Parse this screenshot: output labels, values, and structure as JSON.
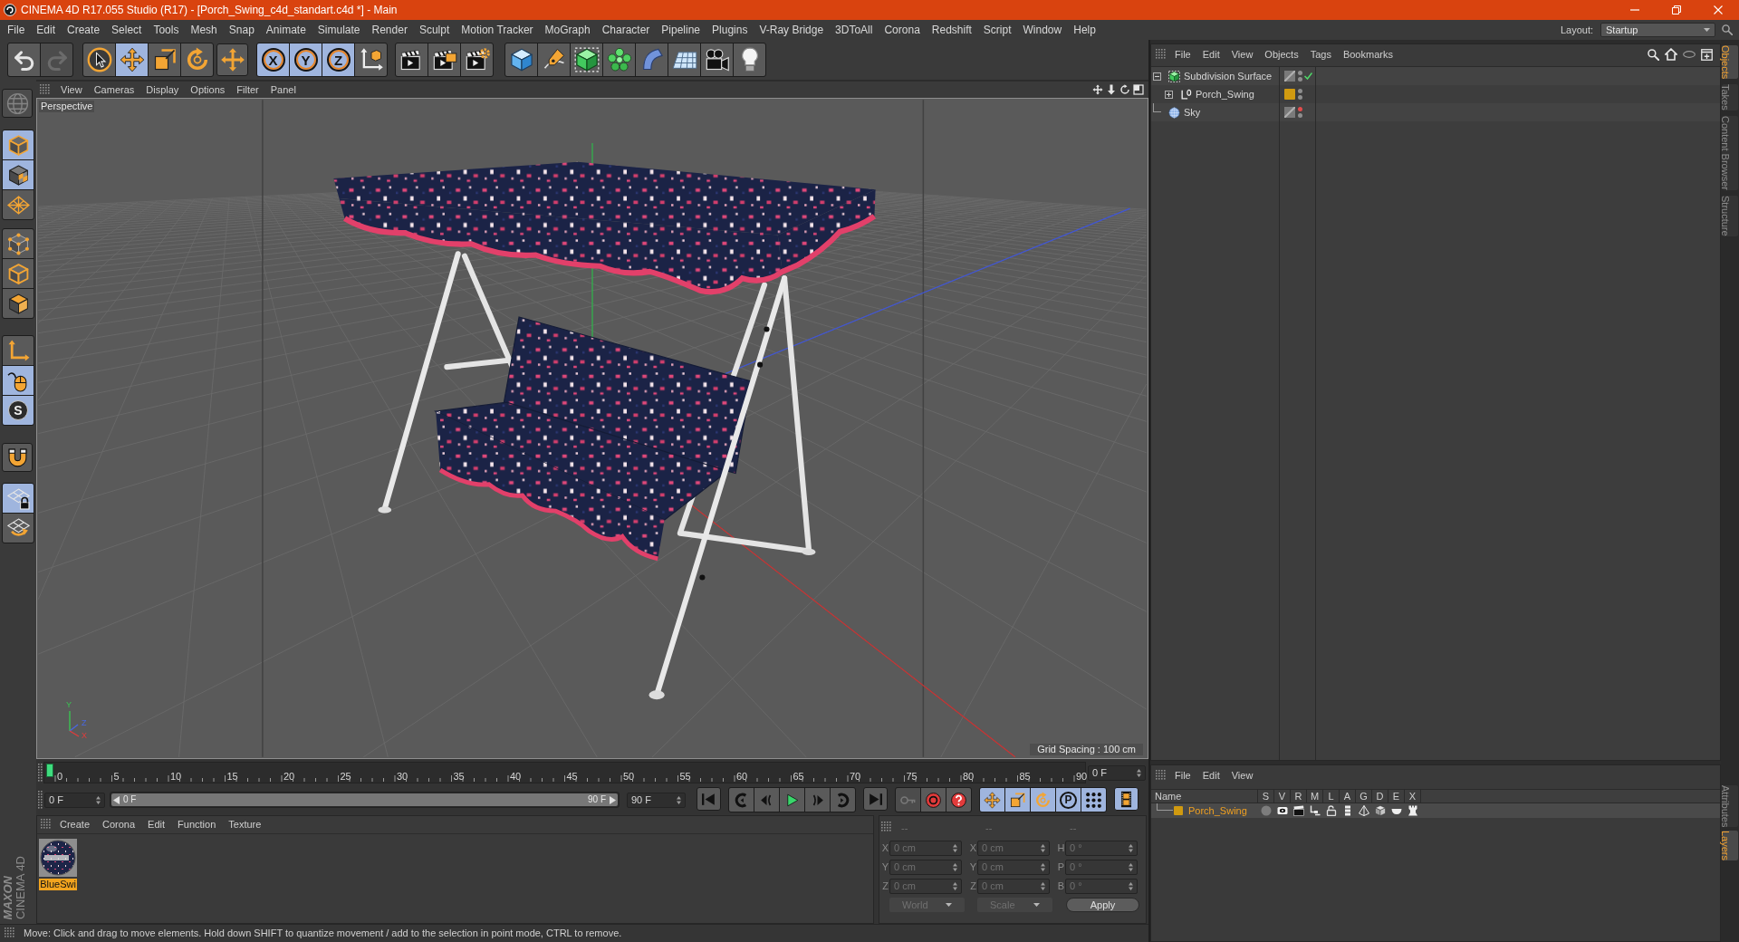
{
  "window": {
    "title": "CINEMA 4D R17.055 Studio (R17) - [Porch_Swing_c4d_standart.c4d *] - Main"
  },
  "menu_bar": {
    "items": [
      "File",
      "Edit",
      "Create",
      "Select",
      "Tools",
      "Mesh",
      "Snap",
      "Animate",
      "Simulate",
      "Render",
      "Sculpt",
      "Motion Tracker",
      "MoGraph",
      "Character",
      "Pipeline",
      "Plugins",
      "V-Ray Bridge",
      "3DToAll",
      "Corona",
      "Redshift",
      "Script",
      "Window",
      "Help"
    ],
    "layout_label": "Layout:",
    "layout_value": "Startup"
  },
  "toolbar": {
    "groups": [
      [
        {
          "active": false,
          "disabled": false
        },
        {
          "active": false,
          "disabled": true
        }
      ],
      [
        {
          "active": false,
          "disabled": false
        },
        {
          "active": true,
          "disabled": false
        },
        {
          "active": false,
          "disabled": false
        },
        {
          "active": false,
          "disabled": false
        }
      ],
      [
        {
          "active": false,
          "disabled": false
        }
      ],
      [
        {
          "label": "X",
          "active": true,
          "disabled": false
        },
        {
          "label": "Y",
          "active": true,
          "disabled": false
        },
        {
          "label": "Z",
          "active": true,
          "disabled": false
        },
        {
          "active": false,
          "disabled": false
        }
      ],
      [
        {
          "active": false,
          "disabled": false
        },
        {
          "active": false,
          "disabled": false
        },
        {
          "active": false,
          "disabled": false
        }
      ],
      [
        {
          "active": false,
          "disabled": false
        },
        {
          "active": false,
          "disabled": false
        },
        {
          "active": false,
          "disabled": false
        },
        {
          "active": false,
          "disabled": false
        },
        {
          "active": false,
          "disabled": false
        },
        {
          "active": false,
          "disabled": false
        },
        {
          "active": false,
          "disabled": false
        },
        {
          "active": false,
          "disabled": false
        }
      ]
    ]
  },
  "left_toolbar": {
    "groups": [
      [
        {
          "active": false,
          "disabled": true
        }
      ],
      [
        {
          "active": true,
          "disabled": false
        },
        {
          "active": true,
          "disabled": false
        },
        {
          "active": false,
          "disabled": false
        }
      ],
      [
        {
          "active": false,
          "disabled": false
        },
        {
          "active": false,
          "disabled": false
        },
        {
          "active": false,
          "disabled": false
        }
      ],
      [
        {
          "active": false,
          "disabled": false
        },
        {
          "active": true,
          "disabled": false
        },
        {
          "label": "S",
          "active": true,
          "disabled": false
        }
      ],
      [
        {
          "active": false,
          "disabled": false
        }
      ],
      [
        {
          "active": true,
          "disabled": false
        },
        {
          "active": false,
          "disabled": false
        }
      ]
    ]
  },
  "viewport": {
    "menu": [
      "View",
      "Cameras",
      "Display",
      "Options",
      "Filter",
      "Panel"
    ],
    "camera": "Perspective",
    "grid_spacing": "Grid Spacing : 100 cm",
    "axis_labels": [
      "Y",
      "Z",
      "X"
    ]
  },
  "timeline": {
    "labels": [
      "0",
      "5",
      "10",
      "15",
      "20",
      "25",
      "30",
      "35",
      "40",
      "45",
      "50",
      "55",
      "60",
      "65",
      "70",
      "75",
      "80",
      "85",
      "90"
    ],
    "playhead": {
      "level": 0
    },
    "frame_field": "0 F"
  },
  "transport": {
    "start_field": "0 F",
    "range": {
      "start": "0 F",
      "end": "90 F",
      "level": 1
    },
    "end_field": "90 F",
    "groups": [
      [
        {
          "active": false,
          "disabled": false
        }
      ],
      [
        {
          "active": false,
          "disabled": false
        },
        {
          "active": false,
          "disabled": false
        },
        {
          "active": false,
          "disabled": false
        },
        {
          "active": false,
          "disabled": false
        },
        {
          "active": false,
          "disabled": false
        }
      ],
      [
        {
          "active": false,
          "disabled": false
        }
      ],
      [
        {
          "active": false,
          "disabled": true
        },
        {
          "active": false,
          "disabled": false
        },
        {
          "active": false,
          "disabled": false
        }
      ],
      [
        {
          "active": true,
          "disabled": false
        },
        {
          "active": true,
          "disabled": false
        },
        {
          "active": true,
          "disabled": false
        },
        {
          "label": "P",
          "active": true,
          "disabled": false
        },
        {
          "active": true,
          "disabled": false
        }
      ],
      [
        {
          "active": true,
          "disabled": false
        }
      ]
    ]
  },
  "material_manager": {
    "menu": [
      "Create",
      "Corona",
      "Edit",
      "Function",
      "Texture"
    ],
    "materials": [
      {
        "name": "BlueSwi",
        "selected": true
      }
    ]
  },
  "coordinates": {
    "disabled": true,
    "headers": [
      "--",
      "--",
      "--"
    ],
    "rows": [
      {
        "labels": [
          "X",
          "X",
          "H"
        ],
        "values": [
          "0 cm",
          "0 cm",
          "0 °"
        ]
      },
      {
        "labels": [
          "Y",
          "Y",
          "P"
        ],
        "values": [
          "0 cm",
          "0 cm",
          "0 °"
        ]
      },
      {
        "labels": [
          "Z",
          "Z",
          "B"
        ],
        "values": [
          "0 cm",
          "0 cm",
          "0 °"
        ]
      }
    ],
    "mode": "World",
    "transform": "Scale",
    "apply": "Apply"
  },
  "logo": {
    "brand": "MAXON",
    "product": "CINEMA 4D"
  },
  "status_bar": "Move: Click and drag to move elements. Hold down SHIFT to quantize movement / add to the selection in point mode, CTRL to remove.",
  "object_manager": {
    "menu": [
      "File",
      "Edit",
      "View",
      "Objects",
      "Tags",
      "Bookmarks"
    ],
    "objects": [
      {
        "name": "Subdivision Surface",
        "kind": "generator",
        "expanded": true,
        "enabled": true,
        "hidden_in_editor": false,
        "hidden_in_render": false,
        "children": [
          {
            "name": "Porch_Swing",
            "kind": "null",
            "expanded": false,
            "color": "#d09a10",
            "hidden_in_editor": false,
            "hidden_in_render": false
          }
        ]
      },
      {
        "name": "Sky",
        "kind": "sky",
        "hidden_in_editor": true,
        "hidden_in_render": false
      }
    ]
  },
  "layer_manager": {
    "menu": [
      "File",
      "Edit",
      "View"
    ],
    "columns": [
      "Name",
      "S",
      "V",
      "R",
      "M",
      "L",
      "A",
      "G",
      "D",
      "E",
      "X"
    ],
    "layers": [
      {
        "name": "Porch_Swing",
        "color": "#d09a10",
        "selected": true,
        "flags": [
          {
            "on": false
          },
          {
            "on": true
          },
          {
            "on": true
          },
          {
            "on": true
          },
          {
            "on": true
          },
          {
            "on": true
          },
          {
            "on": true
          },
          {
            "on": true
          },
          {
            "on": true
          },
          {
            "on": true
          }
        ]
      }
    ]
  },
  "side_tabs": {
    "top": [
      {
        "label": "Objects",
        "selected": true
      },
      {
        "label": "Takes",
        "selected": false
      },
      {
        "label": "Content Browser",
        "selected": false
      },
      {
        "label": "Structure",
        "selected": false
      }
    ],
    "bottom": [
      {
        "label": "Attributes",
        "selected": false
      },
      {
        "label": "Layers",
        "selected": true
      }
    ]
  }
}
